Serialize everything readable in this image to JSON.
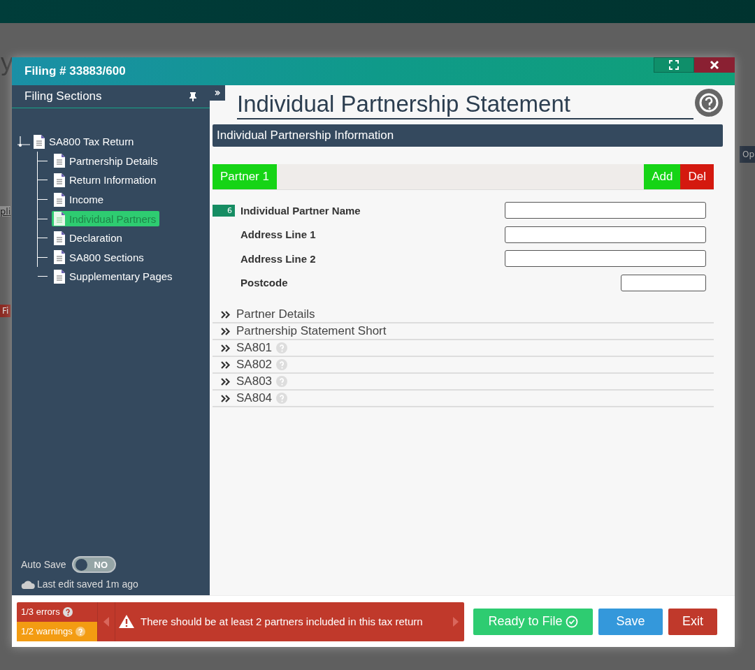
{
  "background": {
    "fragments": [
      {
        "text": "y",
        "kind": "heading"
      },
      {
        "text": "pli",
        "kind": "link"
      },
      {
        "text": "Fi",
        "kind": "tag"
      },
      {
        "text": "Op",
        "kind": "tab"
      }
    ]
  },
  "window": {
    "title": "Filing # 33883/600"
  },
  "sidebar": {
    "title": "Filing Sections",
    "tree": {
      "label": "SA800 Tax Return",
      "selected": false,
      "children": [
        {
          "label": "Partnership Details",
          "selected": false
        },
        {
          "label": "Return Information",
          "selected": false
        },
        {
          "label": "Income",
          "selected": false
        },
        {
          "label": "Individual Partners",
          "selected": true
        },
        {
          "label": "Declaration",
          "selected": false
        },
        {
          "label": "SA800 Sections",
          "selected": false
        },
        {
          "label": "Supplementary Pages",
          "selected": false
        }
      ]
    },
    "auto_save": {
      "label": "Auto Save",
      "on": false,
      "state_text": "NO"
    },
    "last_saved": "Last edit saved 1m ago"
  },
  "page": {
    "title": "Individual Partnership Statement",
    "section": "Individual Partnership Information",
    "partner_tab": "Partner 1",
    "add_button": "Add",
    "delete_button": "Del",
    "fields": [
      {
        "badge": "6",
        "label": "Individual Partner Name",
        "kind": "long"
      },
      {
        "label": "Address Line 1",
        "kind": "long"
      },
      {
        "label": "Address Line 2",
        "kind": "long"
      },
      {
        "label": "Postcode",
        "kind": "short"
      }
    ],
    "panels": [
      {
        "label": "Partner Details",
        "help": false
      },
      {
        "label": "Partnership Statement Short",
        "help": false
      },
      {
        "label": "SA801",
        "help": true
      },
      {
        "label": "SA802",
        "help": true
      },
      {
        "label": "SA803",
        "help": true
      },
      {
        "label": "SA804",
        "help": true
      }
    ]
  },
  "footer": {
    "errors": "1/3 errors",
    "warnings": "1/2 warnings",
    "message": "There should be at least 2 partners included in this tax return",
    "buttons": [
      {
        "label": "Ready to File",
        "kind": "ready"
      },
      {
        "label": "Save",
        "kind": "save"
      },
      {
        "label": "Exit",
        "kind": "exit"
      }
    ]
  }
}
